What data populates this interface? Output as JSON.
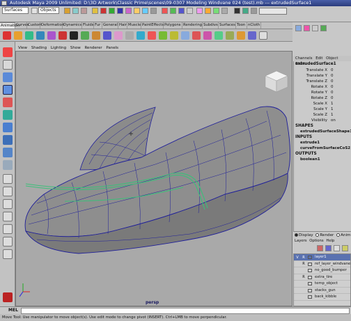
{
  "window": {
    "title": "Autodesk Maya 2009 Unlimited: D:\\3D Artwork\\Classic Prime\\scenes\\09-0307 Modeling Windvane 024 (test).mb   ---   extrudedSurface1"
  },
  "topbar": {
    "mode_menu": "Surfaces",
    "selection_mask": "Objects"
  },
  "shelf": {
    "tabs": [
      "Animation",
      "Curves",
      "Custom",
      "Deformation",
      "Dynamics",
      "Fluids",
      "Fur",
      "General",
      "Hair",
      "Muscle",
      "PaintEffects",
      "Polygons",
      "Rendering",
      "Subdivs",
      "Surfaces",
      "Toon",
      "nCloth"
    ],
    "active_tab": "Animation"
  },
  "panel_menu": {
    "items": [
      "View",
      "Shading",
      "Lighting",
      "Show",
      "Renderer",
      "Panels"
    ]
  },
  "viewport": {
    "camera_label": "persp"
  },
  "channel_box": {
    "menu": [
      "Channels",
      "Edit",
      "Object",
      "Show"
    ],
    "object_name": "extrudedSurface1",
    "channels": [
      {
        "label": "Translate X",
        "value": "0"
      },
      {
        "label": "Translate Y",
        "value": "0"
      },
      {
        "label": "Translate Z",
        "value": "0"
      },
      {
        "label": "Rotate X",
        "value": "0"
      },
      {
        "label": "Rotate Y",
        "value": "0"
      },
      {
        "label": "Rotate Z",
        "value": "0"
      },
      {
        "label": "Scale X",
        "value": "1"
      },
      {
        "label": "Scale Y",
        "value": "1"
      },
      {
        "label": "Scale Z",
        "value": "1"
      },
      {
        "label": "Visibility",
        "value": "on"
      }
    ],
    "shapes_header": "SHAPES",
    "shapes": [
      "extrudedSurfaceShape1"
    ],
    "inputs_header": "INPUTS",
    "inputs": [
      "extrude1",
      "curveFromSurfaceCoS2"
    ],
    "outputs_header": "OUTPUTS",
    "outputs": [
      "boolean1"
    ]
  },
  "layer_editor": {
    "modes": [
      "Display",
      "Render",
      "Anim"
    ],
    "active_mode": "Display",
    "menu": [
      "Layers",
      "Options",
      "Help"
    ],
    "layers": [
      {
        "name": "layer1",
        "vis": "V",
        "ref": "R",
        "selected": true
      },
      {
        "name": "ref_layer_windvane",
        "vis": "",
        "ref": "R",
        "selected": false
      },
      {
        "name": "no_good_bumper",
        "vis": "",
        "ref": "",
        "selected": false
      },
      {
        "name": "extra_tire",
        "vis": "",
        "ref": "R",
        "selected": false
      },
      {
        "name": "temp_object",
        "vis": "",
        "ref": "",
        "selected": false
      },
      {
        "name": "stacks_gun",
        "vis": "",
        "ref": "",
        "selected": false
      },
      {
        "name": "back_kibble",
        "vis": "",
        "ref": "",
        "selected": false
      }
    ]
  },
  "command_line": {
    "label": "MEL"
  },
  "help_line": {
    "text": "Move Tool: Use manipulator to move object(s). Use edit mode to change pivot (INSERT). Ctrl+LMB to move perpendicular."
  },
  "colors": {
    "title_bar": "#2b3c7e",
    "wireframe": "#1e1e9a",
    "highlight_curve": "#3cbf7a",
    "layer_selected": "#5a72b0"
  }
}
